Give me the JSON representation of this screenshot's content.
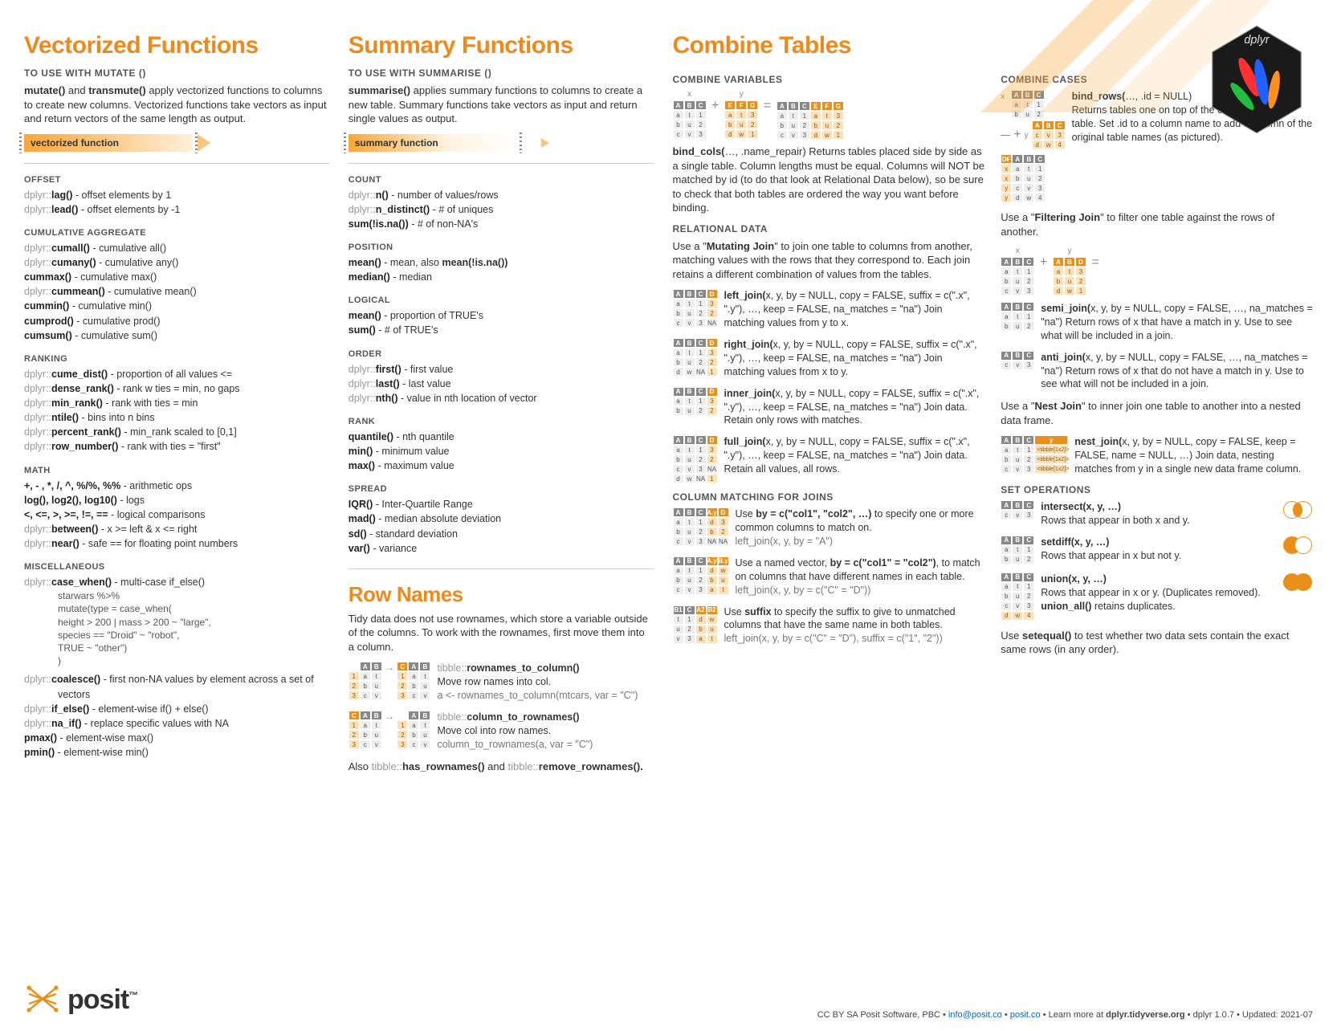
{
  "titles": {
    "vectorized": "Vectorized Functions",
    "summary": "Summary Functions",
    "rownames": "Row Names",
    "combine": "Combine Tables"
  },
  "subheads": {
    "use_mutate": "TO USE WITH MUTATE ()",
    "use_summarise": "TO USE WITH SUMMARISE ()",
    "combine_vars": "COMBINE VARIABLES",
    "combine_cases": "COMBINE CASES",
    "relational": "RELATIONAL DATA",
    "col_matching": "COLUMN MATCHING FOR JOINS",
    "set_ops": "SET OPERATIONS"
  },
  "intros": {
    "mutate": "mutate() and transmute() apply vectorized functions to columns to create new columns. Vectorized functions take vectors as input and return vectors of the same length as output.",
    "summarise": "summarise() applies summary functions to columns to create a new table. Summary functions take vectors as input and return single values as output.",
    "rownames": "Tidy data does not use rownames, which store a variable outside of the columns. To work with the rownames, first move them into a column.",
    "mutating_join": "Use a \"Mutating Join\" to join one table to columns from another, matching values with the rows that they correspond to. Each join retains a different combination of values from the tables.",
    "filtering_join": "Use a \"Filtering Join\" to filter one table against the rows of another.",
    "nest_join": "Use a \"Nest Join\" to inner join one table to another into a nested data frame.",
    "setequal": "Use setequal() to test whether two data sets contain the exact same rows (in any order)."
  },
  "arrows": {
    "vectorized": "vectorized function",
    "summary": "summary function"
  },
  "vec": {
    "offset": {
      "label": "OFFSET",
      "items": [
        {
          "ns": "dplyr::",
          "fn": "lag()",
          "d": " - offset elements by 1"
        },
        {
          "ns": "dplyr::",
          "fn": "lead()",
          "d": " - offset elements by -1"
        }
      ]
    },
    "cumagg": {
      "label": "CUMULATIVE AGGREGATE",
      "items": [
        {
          "ns": "dplyr::",
          "fn": "cumall()",
          "d": " - cumulative all()"
        },
        {
          "ns": "dplyr::",
          "fn": "cumany()",
          "d": " - cumulative any()"
        },
        {
          "ns": "",
          "fn": "cummax()",
          "d": " - cumulative max()"
        },
        {
          "ns": "dplyr::",
          "fn": "cummean()",
          "d": " - cumulative mean()"
        },
        {
          "ns": "",
          "fn": "cummin()",
          "d": " - cumulative min()"
        },
        {
          "ns": "",
          "fn": "cumprod()",
          "d": " - cumulative prod()"
        },
        {
          "ns": "",
          "fn": "cumsum()",
          "d": " - cumulative sum()"
        }
      ]
    },
    "ranking": {
      "label": "RANKING",
      "items": [
        {
          "ns": "dplyr::",
          "fn": "cume_dist()",
          "d": " - proportion of all values <="
        },
        {
          "ns": "dplyr::",
          "fn": "dense_rank()",
          "d": " - rank w ties = min, no gaps"
        },
        {
          "ns": "dplyr::",
          "fn": "min_rank()",
          "d": " - rank with ties = min"
        },
        {
          "ns": "dplyr::",
          "fn": "ntile()",
          "d": " - bins into n bins"
        },
        {
          "ns": "dplyr::",
          "fn": "percent_rank()",
          "d": " - min_rank scaled to [0,1]"
        },
        {
          "ns": "dplyr::",
          "fn": "row_number()",
          "d": " - rank with ties = \"first\""
        }
      ]
    },
    "math": {
      "label": "MATH",
      "items": [
        {
          "ns": "",
          "fn": "+, - , *, /, ^, %/%, %%",
          "d": " - arithmetic ops"
        },
        {
          "ns": "",
          "fn": "log(), log2(), log10()",
          "d": " - logs"
        },
        {
          "ns": "",
          "fn": "<, <=, >, >=, !=, ==",
          "d": " - logical comparisons"
        },
        {
          "ns": "dplyr::",
          "fn": "between()",
          "d": " - x >= left & x <= right"
        },
        {
          "ns": "dplyr::",
          "fn": "near()",
          "d": " - safe == for floating point numbers"
        }
      ]
    },
    "misc": {
      "label": "MISCELLANEOUS",
      "case_when": {
        "ns": "dplyr::",
        "fn": "case_when()",
        "d": " - multi-case if_else()"
      },
      "code_lines": [
        "starwars %>%",
        "  mutate(type = case_when(",
        "    height > 200 | mass > 200   ~ \"large\",",
        "    species == \"Droid\"               ~ \"robot\",",
        "    TRUE                                      ~ \"other\")",
        "  )"
      ],
      "rest": [
        {
          "ns": "dplyr::",
          "fn": "coalesce()",
          "d": " - first non-NA values by element  across a set of vectors"
        },
        {
          "ns": "dplyr::",
          "fn": "if_else()",
          "d": " - element-wise if() + else()"
        },
        {
          "ns": "dplyr::",
          "fn": "na_if()",
          "d": " - replace specific values with NA"
        },
        {
          "ns": "",
          "fn": "pmax()",
          "d": " - element-wise max()"
        },
        {
          "ns": "",
          "fn": "pmin()",
          "d": " - element-wise min()"
        }
      ]
    }
  },
  "sum": {
    "count": {
      "label": "COUNT",
      "items": [
        {
          "ns": "dplyr::",
          "fn": "n()",
          "d": " - number of values/rows"
        },
        {
          "ns": "dplyr::",
          "fn": "n_distinct()",
          "d": " - # of uniques"
        },
        {
          "ns": "",
          "fn": "sum(!is.na())",
          "d": " - # of non-NA's"
        }
      ]
    },
    "position": {
      "label": "POSITION",
      "items": [
        {
          "ns": "",
          "fn": "mean()",
          "d": " - mean, also mean(!is.na())"
        },
        {
          "ns": "",
          "fn": "median()",
          "d": " - median"
        }
      ]
    },
    "logical": {
      "label": "LOGICAL",
      "items": [
        {
          "ns": "",
          "fn": "mean()",
          "d": " - proportion of TRUE's"
        },
        {
          "ns": "",
          "fn": "sum()",
          "d": " - # of TRUE's"
        }
      ]
    },
    "order": {
      "label": "ORDER",
      "items": [
        {
          "ns": "dplyr::",
          "fn": "first()",
          "d": " - first value"
        },
        {
          "ns": "dplyr::",
          "fn": "last()",
          "d": " - last value"
        },
        {
          "ns": "dplyr::",
          "fn": "nth()",
          "d": " - value in nth location of vector"
        }
      ]
    },
    "rank": {
      "label": "RANK",
      "items": [
        {
          "ns": "",
          "fn": "quantile()",
          "d": " - nth quantile"
        },
        {
          "ns": "",
          "fn": "min()",
          "d": " - minimum value"
        },
        {
          "ns": "",
          "fn": "max()",
          "d": " - maximum value"
        }
      ]
    },
    "spread": {
      "label": "SPREAD",
      "items": [
        {
          "ns": "",
          "fn": "IQR()",
          "d": " - Inter-Quartile Range"
        },
        {
          "ns": "",
          "fn": "mad()",
          "d": " - median absolute deviation"
        },
        {
          "ns": "",
          "fn": "sd()",
          "d": " - standard deviation"
        },
        {
          "ns": "",
          "fn": "var()",
          "d": " - variance"
        }
      ]
    }
  },
  "rownames": {
    "r2c": {
      "ns": "tibble::",
      "fn": "rownames_to_column()",
      "d": "Move row names into col.",
      "ex": "a <- rownames_to_column(mtcars, var = \"C\")"
    },
    "c2r": {
      "ns": "tibble::",
      "fn": "column_to_rownames()",
      "d": "Move col into row names.",
      "ex": "column_to_rownames(a, var = \"C\")"
    },
    "also_pre": "Also ",
    "also_ns": "tibble::",
    "has": "has_rownames()",
    "and": " and ",
    "remove_ns": "tibble::",
    "remove": "remove_rownames()."
  },
  "combine": {
    "bind_cols": {
      "fn": "bind_cols(",
      "args": "…, .name_repair)",
      "d": " Returns tables placed side by side as a single table. Column lengths must be equal. Columns will NOT be matched by id (to do that look at Relational Data below), so be sure to check that both tables are ordered the way you want before binding."
    },
    "bind_rows": {
      "fn": "bind_rows(",
      "args": "…, .id = NULL)",
      "d": " Returns tables one on top of the other as a single table. Set .id to a column name to add a column of the original table names (as pictured)."
    },
    "left_join": {
      "fn": "left_join(",
      "args": "x, y, by = NULL, copy = FALSE, suffix = c(\".x\", \".y\"), …, keep = FALSE, na_matches = \"na\")",
      "d": " Join matching values from y to x."
    },
    "right_join": {
      "fn": "right_join(",
      "args": "x, y, by = NULL, copy = FALSE, suffix = c(\".x\", \".y\"), …, keep = FALSE, na_matches = \"na\")",
      "d": " Join matching values from x to y."
    },
    "inner_join": {
      "fn": "inner_join(",
      "args": "x, y, by = NULL, copy = FALSE, suffix = c(\".x\", \".y\"), …, keep = FALSE, na_matches = \"na\")",
      "d": " Join data. Retain only rows with matches."
    },
    "full_join": {
      "fn": "full_join(",
      "args": "x, y, by = NULL, copy = FALSE, suffix = c(\".x\", \".y\"), …, keep = FALSE, na_matches = \"na\")",
      "d": " Join data. Retain all values, all rows."
    },
    "semi_join": {
      "fn": "semi_join(",
      "args": "x, y, by = NULL, copy = FALSE, …, na_matches = \"na\")",
      "d": " Return rows of x that have a match in y.  Use to see what will be included in a join."
    },
    "anti_join": {
      "fn": "anti_join(",
      "args": "x, y, by = NULL, copy = FALSE, …, na_matches = \"na\")",
      "d": " Return rows of x that do not have a match in y. Use to see what will not be included in a join."
    },
    "nest_join": {
      "fn": "nest_join(",
      "args": "x, y, by = NULL, copy = FALSE, keep = FALSE, name = NULL, …)",
      "d": " Join data, nesting matches from y in a single new data frame column."
    },
    "by1": {
      "t": "Use by = c(\"col1\", \"col2\", …)  to specify one or more common columns to match on.",
      "ex": "left_join(x, y, by = \"A\")"
    },
    "by2": {
      "t": "Use a named vector,  by = c(\"col1\" = \"col2\"), to match on columns that have different names in each table.",
      "ex": "left_join(x, y, by = c(\"C\" = \"D\"))"
    },
    "by3": {
      "t": "Use suffix to specify the suffix to give to unmatched columns that have the same name in both tables.",
      "ex": "left_join(x, y, by = c(\"C\" = \"D\"), suffix = c(\"1\", \"2\"))"
    },
    "intersect": {
      "fn": "intersect(x, y, …)",
      "d": "Rows that appear in both x and y."
    },
    "setdiff": {
      "fn": "setdiff(x, y, …)",
      "d": "Rows that appear in x but not y."
    },
    "union": {
      "fn": "union(x, y, …)",
      "d": "Rows that appear in x or y. (Duplicates removed). union_all() retains duplicates."
    }
  },
  "footer": {
    "cc": "CC BY SA Posit Software, PBC",
    "sep": " • ",
    "email": "info@posit.co",
    "site": "posit.co",
    "learn": "Learn more at ",
    "pkg_site": "dplyr.tidyverse.org",
    "ver": "dplyr  1.0.7",
    "updated": "Updated:  2021-07"
  },
  "logo_text": "posit",
  "hex_label": "dplyr"
}
